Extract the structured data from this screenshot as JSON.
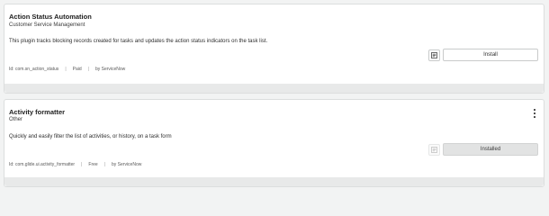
{
  "plugins": [
    {
      "title": "Action Status Automation",
      "category": "Customer Service Management",
      "description": "This plugin tracks blocking records created for tasks and updates the action status indicators on the task list.",
      "meta": {
        "id_text": "Id: com.sn_action_status",
        "price": "Paid",
        "vendor": "by ServiceNow"
      },
      "action_label": "Install",
      "icon": "document-list-icon"
    },
    {
      "title": "Activity formatter",
      "category": "Other",
      "description": "Quickly and easily filter the list of activities, or history, on a task form",
      "meta": {
        "id_text": "Id: com.glide.ui.activity_formatter",
        "price": "Free",
        "vendor": "by ServiceNow"
      },
      "action_label": "Installed",
      "icon": "document-list-icon",
      "menu_icon": "more-vertical-icon"
    }
  ],
  "separator": "|"
}
